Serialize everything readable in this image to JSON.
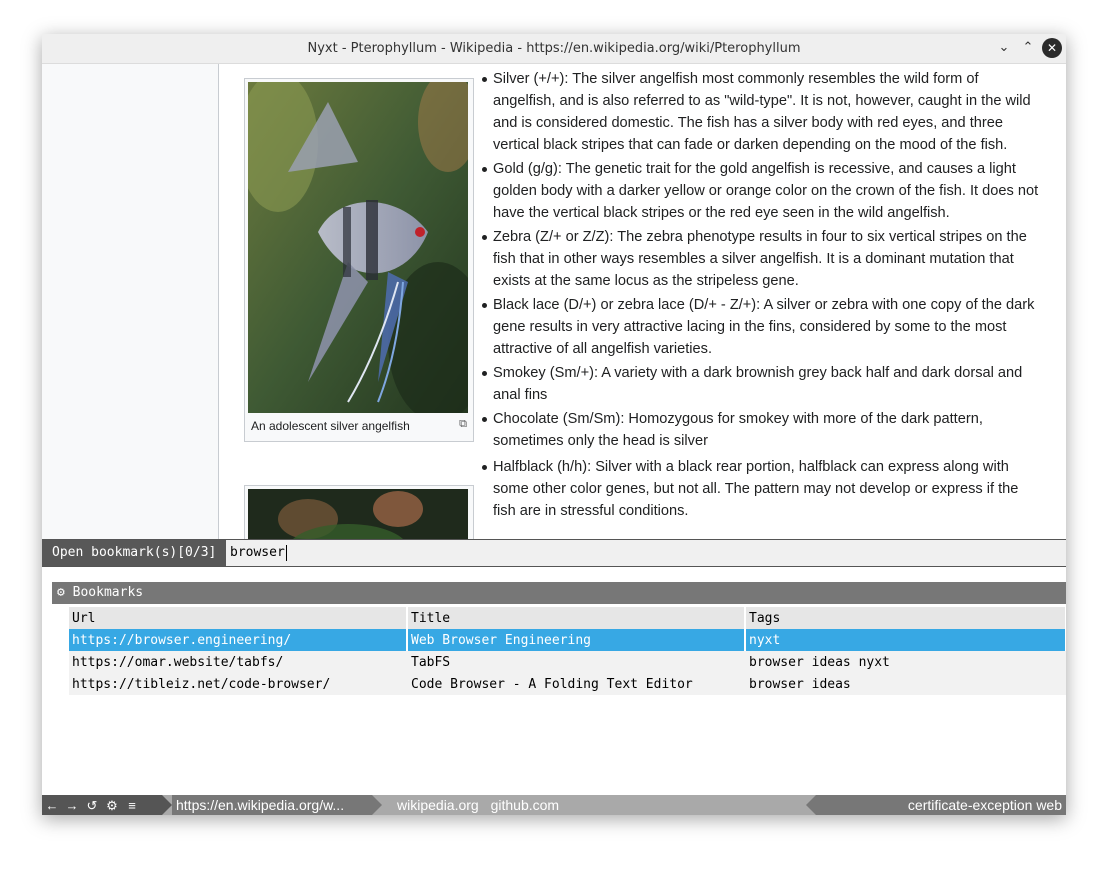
{
  "window": {
    "title": "Nyxt - Pterophyllum - Wikipedia - https://en.wikipedia.org/wiki/Pterophyllum",
    "controls": {
      "minimize_icon": "chevron-down-icon",
      "maximize_icon": "chevron-up-icon",
      "close_icon": "close-icon",
      "close_glyph": "✕",
      "minimize_glyph": "⌄",
      "maximize_glyph": "⌃"
    }
  },
  "page": {
    "figures": [
      {
        "caption": "An adolescent silver angelfish",
        "enlarge_icon": "enlarge-icon"
      },
      {
        "caption": ""
      }
    ],
    "varieties": [
      "Silver (+/+): The silver angelfish most commonly resembles the wild form of angelfish, and is also referred to as \"wild-type\". It is not, however, caught in the wild and is considered domestic. The fish has a silver body with red eyes, and three vertical black stripes that can fade or darken depending on the mood of the fish.",
      "Gold (g/g): The genetic trait for the gold angelfish is recessive, and causes a light golden body with a darker yellow or orange color on the crown of the fish. It does not have the vertical black stripes or the red eye seen in the wild angelfish.",
      "Zebra (Z/+ or Z/Z): The zebra phenotype results in four to six vertical stripes on the fish that in other ways resembles a silver angelfish. It is a dominant mutation that exists at the same locus as the stripeless gene.",
      "Black lace (D/+) or zebra lace (D/+ - Z/+): A silver or zebra with one copy of the dark gene results in very attractive lacing in the fins, considered by some to the most attractive of all angelfish varieties.",
      "Smokey (Sm/+): A variety with a dark brownish grey back half and dark dorsal and anal fins",
      "Chocolate (Sm/Sm): Homozygous for smokey with more of the dark pattern, sometimes only the head is silver",
      "Halfblack (h/h): Silver with a black rear portion, halfblack can express along with some other color genes, but not all. The pattern may not develop or express if the fish are in stressful conditions."
    ]
  },
  "prompt": {
    "label": "Open bookmark(s)[0/3]",
    "input_value": "browser"
  },
  "suggestions": {
    "source_icon": "gear-icon",
    "source_icon_glyph": "⚙",
    "source_name": "Bookmarks",
    "columns": [
      "Url",
      "Title",
      "Tags"
    ],
    "rows": [
      [
        "https://browser.engineering/",
        "Web Browser Engineering",
        "nyxt"
      ],
      [
        "https://omar.website/tabfs/",
        "TabFS",
        "browser ideas nyxt"
      ],
      [
        "https://tibleiz.net/code-browser/",
        "Code Browser - A Folding Text Editor",
        "browser ideas"
      ]
    ],
    "selected_row": 0
  },
  "status_bar": {
    "nav_buttons": [
      {
        "name": "back-icon",
        "glyph": "←"
      },
      {
        "name": "forward-icon",
        "glyph": "→"
      },
      {
        "name": "reload-icon",
        "glyph": "↺"
      },
      {
        "name": "settings-icon",
        "glyph": "⚙"
      },
      {
        "name": "menu-icon",
        "glyph": "≡"
      }
    ],
    "url": "https://en.wikipedia.org/w...",
    "tabs": [
      "wikipedia.org",
      "github.com"
    ],
    "modes": "certificate-exception web"
  },
  "colors": {
    "selection": "#37a8e4",
    "prompt_label_bg": "#585858",
    "source_header_bg": "#777777",
    "status_bg": "#a9a9a9"
  }
}
